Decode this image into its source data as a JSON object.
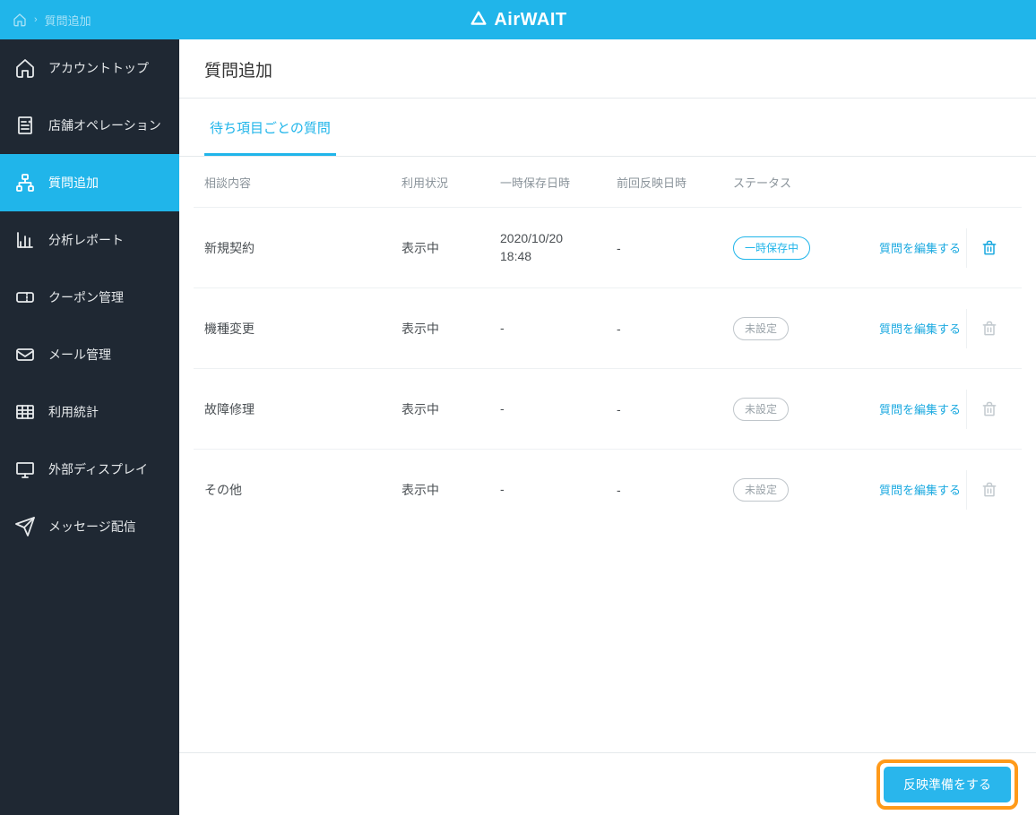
{
  "header": {
    "brand_prefix": "Air",
    "brand_suffix": "WAIT",
    "breadcrumb_current": "質問追加"
  },
  "sidebar": {
    "items": [
      {
        "label": "アカウントトップ",
        "icon": "home"
      },
      {
        "label": "店舗オペレーション",
        "icon": "receipt"
      },
      {
        "label": "質問追加",
        "icon": "sitemap",
        "active": true
      },
      {
        "label": "分析レポート",
        "icon": "chart"
      },
      {
        "label": "クーポン管理",
        "icon": "ticket"
      },
      {
        "label": "メール管理",
        "icon": "mail"
      },
      {
        "label": "利用統計",
        "icon": "table"
      },
      {
        "label": "外部ディスプレイ",
        "icon": "display"
      },
      {
        "label": "メッセージ配信",
        "icon": "send"
      }
    ]
  },
  "page": {
    "title": "質問追加",
    "tab_label": "待ち項目ごとの質問"
  },
  "table": {
    "columns": [
      "相談内容",
      "利用状況",
      "一時保存日時",
      "前回反映日時",
      "ステータス"
    ],
    "edit_label": "質問を編集する",
    "status_saved": "一時保存中",
    "status_unset": "未設定",
    "rows": [
      {
        "consult": "新規契約",
        "usage": "表示中",
        "saved_at": "2020/10/20 18:48",
        "applied_at": "-",
        "status": "saved",
        "deletable": true
      },
      {
        "consult": "機種変更",
        "usage": "表示中",
        "saved_at": "-",
        "applied_at": "-",
        "status": "unset",
        "deletable": false
      },
      {
        "consult": "故障修理",
        "usage": "表示中",
        "saved_at": "-",
        "applied_at": "-",
        "status": "unset",
        "deletable": false
      },
      {
        "consult": "その他",
        "usage": "表示中",
        "saved_at": "-",
        "applied_at": "-",
        "status": "unset",
        "deletable": false
      }
    ]
  },
  "footer": {
    "apply_label": "反映準備をする"
  }
}
